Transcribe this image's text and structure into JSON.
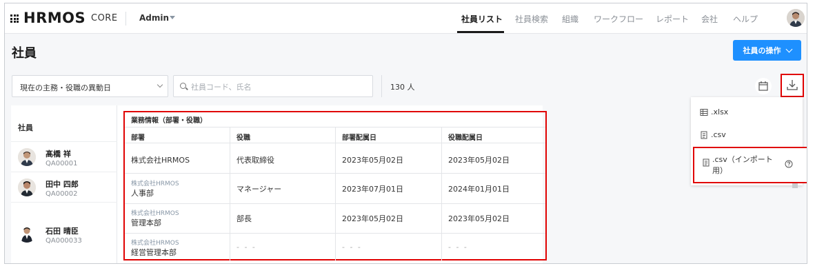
{
  "header": {
    "logo": "HRMOS",
    "logo_sub": "CORE",
    "role": "Admin",
    "nav": [
      "社員リスト",
      "社員検索",
      "組織",
      "ワークフロー",
      "レポート",
      "会社",
      "ヘルプ"
    ]
  },
  "page": {
    "title": "社員",
    "ops_button": "社員の操作"
  },
  "filters": {
    "select_value": "現在の主務・役職の異動日",
    "search_placeholder": "社員コード、氏名",
    "count": "130 人"
  },
  "table": {
    "employee_header": "社員",
    "group_header": "業務情報（部署・役職）",
    "columns": [
      "部署",
      "役職",
      "部署配属日",
      "役職配属日"
    ],
    "employees": [
      {
        "name": "髙橋 祥",
        "code": "QA00001"
      },
      {
        "name": "田中 四郎",
        "code": "QA00002"
      },
      {
        "name": "石田 晴臣",
        "code": "QA000033"
      }
    ],
    "rows": [
      {
        "company": "",
        "dept": "株式会社HRMOS",
        "role": "代表取締役",
        "dept_date": "2023年05月02日",
        "role_date": "2023年05月02日"
      },
      {
        "company": "株式会社HRMOS",
        "dept": "人事部",
        "role": "マネージャー",
        "dept_date": "2023年07月01日",
        "role_date": "2024年01月01日"
      },
      {
        "company": "株式会社HRMOS",
        "dept": "管理本部",
        "role": "部長",
        "dept_date": "2023年05月02日",
        "role_date": "2023年05月02日"
      },
      {
        "company": "株式会社HRMOS",
        "dept": "経営管理本部",
        "role": "- - -",
        "dept_date": "- - -",
        "role_date": "- - -"
      }
    ]
  },
  "download_menu": {
    "items": [
      ".xlsx",
      ".csv",
      ".csv（インポート用）"
    ]
  },
  "colors": {
    "accent": "#1e90ff",
    "highlight": "#e00000"
  }
}
